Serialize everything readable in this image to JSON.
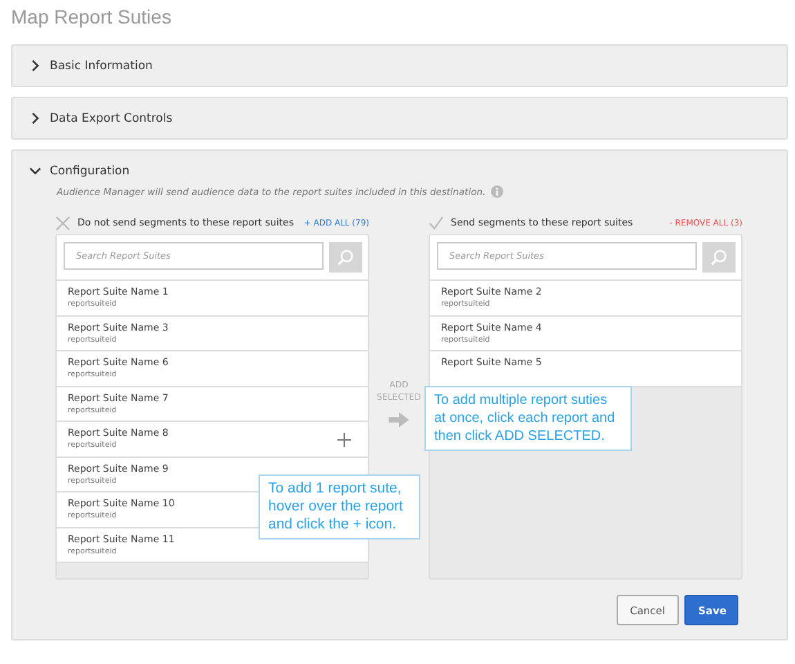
{
  "page_title": "Map Report Suties",
  "sections": [
    {
      "title": "Basic Information",
      "expanded": false
    },
    {
      "title": "Data Export Controls",
      "expanded": false
    },
    {
      "title": "Configuration",
      "expanded": true
    }
  ],
  "configuration": {
    "description": "Audience Manager will send audience data to the report suites included in this destination.",
    "columns": [
      {
        "kind": "exclude",
        "heading": "Do not send segments to these report suites",
        "action": "+ ADD ALL (79)",
        "search_placeholder": "Search Report Suites",
        "items": [
          {
            "name": "Report Suite Name 1",
            "id": "reportsuiteid",
            "hovered": false
          },
          {
            "name": "Report Suite Name 3",
            "id": "reportsuiteid",
            "hovered": false
          },
          {
            "name": "Report Suite Name 6",
            "id": "reportsuiteid",
            "hovered": false
          },
          {
            "name": "Report Suite Name 7",
            "id": "reportsuiteid",
            "hovered": false
          },
          {
            "name": "Report Suite Name 8",
            "id": "reportsuiteid",
            "hovered": true
          },
          {
            "name": "Report Suite Name 9",
            "id": "reportsuiteid",
            "hovered": false
          },
          {
            "name": "Report Suite Name 10",
            "id": "reportsuiteid",
            "hovered": false
          },
          {
            "name": "Report Suite Name 11",
            "id": "reportsuiteid",
            "hovered": false
          }
        ]
      },
      {
        "kind": "include",
        "heading": "Send segments to these report suites",
        "action": "- REMOVE ALL (3)",
        "search_placeholder": "Search Report Suites",
        "items": [
          {
            "name": "Report Suite Name 2",
            "id": "reportsuiteid",
            "hovered": false
          },
          {
            "name": "Report Suite Name 4",
            "id": "reportsuiteid",
            "hovered": false
          },
          {
            "name": "Report Suite Name 5",
            "hovered": false
          }
        ]
      }
    ],
    "add_selected": "ADD SELECTED",
    "tooltips": [
      "To add 1 report sute, hover over the report and click the + icon.",
      "To add multiple report suties at once, click each report and then click ADD SELECTED."
    ]
  },
  "buttons": [
    {
      "label": "Cancel",
      "kind": "secondary"
    },
    {
      "label": "Save",
      "kind": "primary"
    }
  ]
}
